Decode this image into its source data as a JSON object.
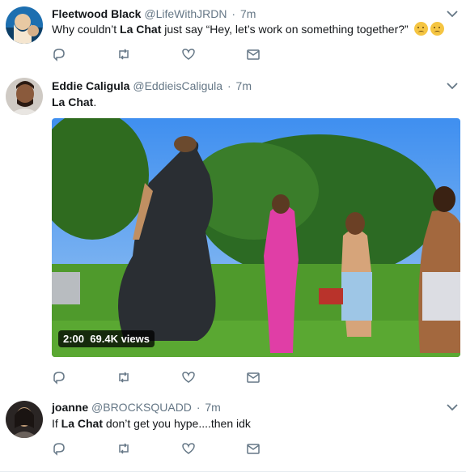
{
  "tweets": [
    {
      "name": "Fleetwood Black",
      "handle": "@LifeWithJRDN",
      "time": "7m",
      "text_pre": "Why couldn’t ",
      "text_bold": "La Chat",
      "text_post": " just say “Hey, let’s work on something together?”",
      "avatar_icon": "avatar-fleetwood-icon"
    },
    {
      "name": "Eddie Caligula",
      "handle": "@EddieisCaligula",
      "time": "7m",
      "text_bold": "La Chat",
      "text_post": ".",
      "avatar_icon": "avatar-eddie-icon",
      "video": {
        "duration": "2:00",
        "views": "69.4K views"
      }
    },
    {
      "name": "joanne",
      "handle": "@BROCKSQUADD",
      "time": "7m",
      "text_pre": "If ",
      "text_bold": "La Chat",
      "text_post": " don’t get you hype....then idk",
      "avatar_icon": "avatar-joanne-icon"
    }
  ],
  "separator": "·",
  "icons": [
    "reply-icon",
    "retweet-icon",
    "like-icon",
    "message-icon",
    "chevron-down-icon"
  ],
  "colors": {
    "text": "#14171a",
    "secondary": "#657786",
    "border": "#e6ecf0"
  }
}
